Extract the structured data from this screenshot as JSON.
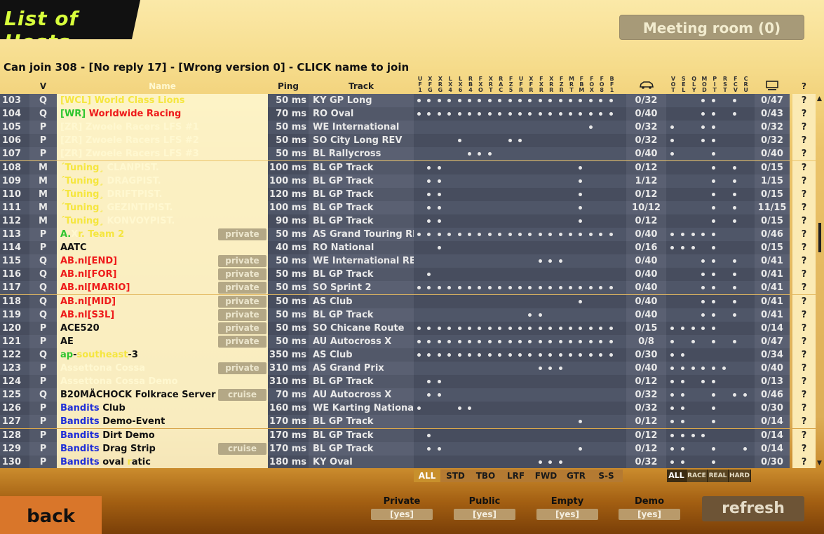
{
  "window": {
    "title": "List of Hosts",
    "meeting_room": "Meeting room (0)"
  },
  "status": "Can join 308 - [No reply 17] - [Wrong version 0] - CLICK name to join",
  "headers": {
    "v": "V",
    "name": "Name",
    "ping": "Ping",
    "track": "Track",
    "question": "?"
  },
  "car_columns": [
    "UF1",
    "XFG",
    "XRG",
    "LX4",
    "LX6",
    "RB4",
    "FXO",
    "XRT",
    "RAC",
    "FZ5",
    "UFR",
    "XFR",
    "FXR",
    "XRR",
    "FZR",
    "MRT",
    "FBM",
    "FOX",
    "FO8",
    "BF1"
  ],
  "flag_columns": [
    "VOT",
    "SEL",
    "QLY",
    "MOD",
    "PIT",
    "RST",
    "FCV",
    "CRU"
  ],
  "icons": {
    "slots": "car-icon",
    "total": "monitor-icon"
  },
  "rows": [
    {
      "no": "103",
      "v": "Q",
      "name": [
        [
          "[WCL] ",
          "#f5e640"
        ],
        [
          "World Class Lions",
          "#f5e640"
        ]
      ],
      "tag": "",
      "ping": "50 ms",
      "track": "KY GP Long",
      "cars": [
        0,
        1,
        2,
        3,
        4,
        5,
        6,
        7,
        8,
        9,
        10,
        11,
        12,
        13,
        14,
        15,
        16,
        17,
        18,
        19
      ],
      "slots": "0/32",
      "flags": [
        3,
        4,
        6
      ],
      "total": "0/47"
    },
    {
      "no": "104",
      "v": "Q",
      "name": [
        [
          "[WR] ",
          "#2ec52e"
        ],
        [
          "Worldwide Racing",
          "#ee1a1a"
        ]
      ],
      "tag": "",
      "ping": "70 ms",
      "track": "RO Oval",
      "cars": [
        0,
        1,
        2,
        3,
        4,
        5,
        6,
        7,
        8,
        9,
        10,
        11,
        12,
        13,
        14,
        15,
        16,
        17,
        18,
        19
      ],
      "slots": "0/40",
      "flags": [
        3,
        4,
        6
      ],
      "total": "0/43"
    },
    {
      "no": "105",
      "v": "P",
      "name": [
        [
          "[ZR] Zwoele Racers LFS #1",
          "#fff8d0"
        ]
      ],
      "tag": "",
      "ping": "50 ms",
      "track": "WE International",
      "cars": [
        17
      ],
      "slots": "0/32",
      "flags": [
        0,
        3,
        4
      ],
      "total": "0/32"
    },
    {
      "no": "106",
      "v": "P",
      "name": [
        [
          "[ZR] Zwoele Racers LFS #2",
          "#fff8d0"
        ]
      ],
      "tag": "",
      "ping": "50 ms",
      "track": "SO City Long REV",
      "cars": [
        4,
        9,
        10
      ],
      "slots": "0/32",
      "flags": [
        0,
        3,
        4
      ],
      "total": "0/32"
    },
    {
      "no": "107",
      "v": "P",
      "name": [
        [
          "[ZR] Zwoele Racers LFS #3",
          "#fff8d0"
        ]
      ],
      "tag": "",
      "ping": "50 ms",
      "track": "BL Rallycross",
      "cars": [
        5,
        6,
        7
      ],
      "slots": "0/40",
      "flags": [
        0,
        4
      ],
      "total": "0/40"
    },
    {
      "no": "108",
      "v": "M",
      "name": [
        [
          "´Tuning¸ ",
          "#f5e640"
        ],
        [
          "CLANPIST.",
          "#fff8d0"
        ]
      ],
      "tag": "",
      "ping": "100 ms",
      "track": "BL GP Track",
      "cars": [
        1,
        2,
        16
      ],
      "slots": "0/12",
      "flags": [
        4,
        6
      ],
      "total": "0/15"
    },
    {
      "no": "109",
      "v": "M",
      "name": [
        [
          "´Tuning¸ ",
          "#f5e640"
        ],
        [
          "DRAGPIST.",
          "#fff8d0"
        ]
      ],
      "tag": "",
      "ping": "100 ms",
      "track": "BL GP Track",
      "cars": [
        1,
        2,
        16
      ],
      "slots": "1/12",
      "flags": [
        4,
        6
      ],
      "total": "1/15"
    },
    {
      "no": "110",
      "v": "M",
      "name": [
        [
          "´Tuning¸ ",
          "#f5e640"
        ],
        [
          "DRIFTPIST.",
          "#fff8d0"
        ]
      ],
      "tag": "",
      "ping": "120 ms",
      "track": "BL GP Track",
      "cars": [
        1,
        2,
        16
      ],
      "slots": "0/12",
      "flags": [
        4,
        6
      ],
      "total": "0/15"
    },
    {
      "no": "111",
      "v": "M",
      "name": [
        [
          "´Tuning¸ ",
          "#f5e640"
        ],
        [
          "GEZINTIPIST.",
          "#fff8d0"
        ]
      ],
      "tag": "",
      "ping": "100 ms",
      "track": "BL GP Track",
      "cars": [
        1,
        2,
        16
      ],
      "slots": "10/12",
      "flags": [
        4,
        6
      ],
      "total": "11/15"
    },
    {
      "no": "112",
      "v": "M",
      "name": [
        [
          "´Tuning¸ ",
          "#f5e640"
        ],
        [
          "KONVOYPIST.",
          "#fff8d0"
        ]
      ],
      "tag": "",
      "ping": "90 ms",
      "track": "BL GP Track",
      "cars": [
        1,
        2,
        16
      ],
      "slots": "0/12",
      "flags": [
        4,
        6
      ],
      "total": "0/15"
    },
    {
      "no": "113",
      "v": "P",
      "name": [
        [
          "A.",
          "#2ec52e"
        ],
        [
          "X",
          "#fff8d0"
        ],
        [
          "r. Team 2",
          "#f5e640"
        ]
      ],
      "tag": "private",
      "ping": "50 ms",
      "track": "AS Grand Touring REV",
      "cars": [
        0,
        1,
        2,
        3,
        4,
        5,
        6,
        7,
        8,
        9,
        10,
        11,
        12,
        13,
        14,
        15,
        16,
        17,
        18,
        19
      ],
      "slots": "0/40",
      "flags": [
        0,
        1,
        2,
        3,
        4
      ],
      "total": "0/46"
    },
    {
      "no": "114",
      "v": "P",
      "name": [
        [
          "AATC",
          "#111"
        ]
      ],
      "tag": "",
      "ping": "40 ms",
      "track": "RO National",
      "cars": [
        2
      ],
      "slots": "0/16",
      "flags": [
        0,
        1,
        2,
        4
      ],
      "total": "0/15"
    },
    {
      "no": "115",
      "v": "Q",
      "name": [
        [
          "AB.nl[END]",
          "#ee1a1a"
        ]
      ],
      "tag": "private",
      "ping": "50 ms",
      "track": "WE International REV",
      "cars": [
        12,
        13,
        14
      ],
      "slots": "0/40",
      "flags": [
        3,
        4,
        6
      ],
      "total": "0/41"
    },
    {
      "no": "116",
      "v": "Q",
      "name": [
        [
          "AB.nl[FOR]",
          "#ee1a1a"
        ]
      ],
      "tag": "private",
      "ping": "50 ms",
      "track": "BL GP Track",
      "cars": [
        1
      ],
      "slots": "0/40",
      "flags": [
        3,
        4,
        6
      ],
      "total": "0/41"
    },
    {
      "no": "117",
      "v": "Q",
      "name": [
        [
          "AB.nl[MARIO]",
          "#ee1a1a"
        ]
      ],
      "tag": "private",
      "ping": "50 ms",
      "track": "SO Sprint 2",
      "cars": [
        0,
        1,
        2,
        3,
        4,
        5,
        6,
        7,
        8,
        9,
        10,
        11,
        12,
        13,
        14,
        15,
        16,
        17,
        18,
        19
      ],
      "slots": "0/40",
      "flags": [
        3,
        4,
        6
      ],
      "total": "0/41"
    },
    {
      "no": "118",
      "v": "Q",
      "name": [
        [
          "AB.nl[MID]",
          "#ee1a1a"
        ]
      ],
      "tag": "private",
      "ping": "50 ms",
      "track": "AS Club",
      "cars": [
        16
      ],
      "slots": "0/40",
      "flags": [
        3,
        4,
        6
      ],
      "total": "0/41"
    },
    {
      "no": "119",
      "v": "Q",
      "name": [
        [
          "AB.nl[S3L]",
          "#ee1a1a"
        ]
      ],
      "tag": "private",
      "ping": "50 ms",
      "track": "BL GP Track",
      "cars": [
        11,
        12
      ],
      "slots": "0/40",
      "flags": [
        3,
        4,
        6
      ],
      "total": "0/41"
    },
    {
      "no": "120",
      "v": "P",
      "name": [
        [
          "ACE520",
          "#111"
        ]
      ],
      "tag": "private",
      "ping": "50 ms",
      "track": "SO Chicane Route",
      "cars": [
        0,
        1,
        2,
        3,
        4,
        5,
        6,
        7,
        8,
        9,
        10,
        11,
        12,
        13,
        14,
        15,
        16,
        17,
        18,
        19
      ],
      "slots": "0/15",
      "flags": [
        0,
        1,
        2,
        3,
        4
      ],
      "total": "0/14"
    },
    {
      "no": "121",
      "v": "P",
      "name": [
        [
          "AE",
          "#111"
        ]
      ],
      "tag": "private",
      "ping": "50 ms",
      "track": "AU Autocross X",
      "cars": [
        0,
        1,
        2,
        3,
        4,
        5,
        6,
        7,
        8,
        9,
        10,
        11,
        12,
        13,
        14,
        15,
        16,
        17,
        18,
        19
      ],
      "slots": "0/8",
      "flags": [
        0,
        2,
        4,
        6
      ],
      "total": "0/47"
    },
    {
      "no": "122",
      "v": "Q",
      "name": [
        [
          "ap",
          "#2ec52e"
        ],
        [
          "-",
          "#111"
        ],
        [
          "southeast",
          "#f5e640"
        ],
        [
          "-3",
          "#111"
        ]
      ],
      "tag": "",
      "ping": "350 ms",
      "track": "AS Club",
      "cars": [
        0,
        1,
        2,
        3,
        4,
        5,
        6,
        7,
        8,
        9,
        10,
        11,
        12,
        13,
        14,
        15,
        16,
        17,
        18,
        19
      ],
      "slots": "0/30",
      "flags": [
        0,
        1
      ],
      "total": "0/34"
    },
    {
      "no": "123",
      "v": "P",
      "name": [
        [
          "Assettona Cossa",
          "#fff8d0"
        ]
      ],
      "tag": "private",
      "ping": "310 ms",
      "track": "AS Grand Prix",
      "cars": [
        12,
        13,
        14
      ],
      "slots": "0/40",
      "flags": [
        0,
        1,
        2,
        3,
        4,
        5
      ],
      "total": "0/40"
    },
    {
      "no": "124",
      "v": "P",
      "name": [
        [
          "Assettona Cossa Demo",
          "#fff8d0"
        ]
      ],
      "tag": "",
      "ping": "310 ms",
      "track": "BL GP Track",
      "cars": [
        1,
        2
      ],
      "slots": "0/12",
      "flags": [
        0,
        1,
        3,
        4
      ],
      "total": "0/13"
    },
    {
      "no": "125",
      "v": "Q",
      "name": [
        [
          "B20MÄCHOCK Folkrace Server",
          "#111"
        ]
      ],
      "tag": "cruise",
      "ping": "70 ms",
      "track": "AU Autocross X",
      "cars": [
        1,
        2
      ],
      "slots": "0/32",
      "flags": [
        0,
        1,
        4,
        6,
        7
      ],
      "total": "0/46"
    },
    {
      "no": "126",
      "v": "P",
      "name": [
        [
          "Bandits ",
          "#1f2ed8"
        ],
        [
          "Club",
          "#111"
        ]
      ],
      "tag": "",
      "ping": "160 ms",
      "track": "WE Karting National",
      "cars": [
        0,
        4,
        5
      ],
      "slots": "0/32",
      "flags": [
        0,
        1,
        4
      ],
      "total": "0/30"
    },
    {
      "no": "127",
      "v": "P",
      "name": [
        [
          "Bandits ",
          "#1f2ed8"
        ],
        [
          "Demo-Event",
          "#111"
        ]
      ],
      "tag": "",
      "ping": "170 ms",
      "track": "BL GP Track",
      "cars": [
        16
      ],
      "slots": "0/12",
      "flags": [
        0,
        1,
        4
      ],
      "total": "0/14"
    },
    {
      "no": "128",
      "v": "P",
      "name": [
        [
          "Bandits ",
          "#1f2ed8"
        ],
        [
          "Dirt Demo",
          "#111"
        ]
      ],
      "tag": "",
      "ping": "170 ms",
      "track": "BL GP Track",
      "cars": [
        1
      ],
      "slots": "0/12",
      "flags": [
        0,
        1,
        2,
        3
      ],
      "total": "0/14"
    },
    {
      "no": "129",
      "v": "P",
      "name": [
        [
          "Bandits ",
          "#1f2ed8"
        ],
        [
          "Drag Strip",
          "#111"
        ]
      ],
      "tag": "cruise",
      "ping": "170 ms",
      "track": "BL GP Track",
      "cars": [
        1,
        2,
        16
      ],
      "slots": "0/12",
      "flags": [
        0,
        1,
        4,
        7
      ],
      "total": "0/14"
    },
    {
      "no": "130",
      "v": "P",
      "name": [
        [
          "Bandits ",
          "#1f2ed8"
        ],
        [
          "oval ",
          "#111"
        ],
        [
          "r",
          "#f5e640"
        ],
        [
          "atic",
          "#111"
        ]
      ],
      "tag": "",
      "ping": "180 ms",
      "track": "KY Oval",
      "cars": [
        12,
        13,
        14
      ],
      "slots": "0/32",
      "flags": [
        0,
        1,
        4
      ],
      "total": "0/30"
    }
  ],
  "car_tabs": [
    "ALL",
    "STD",
    "TBO",
    "LRF",
    "FWD",
    "GTR",
    "S-S"
  ],
  "filter_tabs": [
    "ALL",
    "RACE",
    "REAL",
    "HARD"
  ],
  "filters": [
    {
      "label": "Private",
      "value": "[yes]"
    },
    {
      "label": "Public",
      "value": "[yes]"
    },
    {
      "label": "Empty",
      "value": "[yes]"
    },
    {
      "label": "Demo",
      "value": "[yes]"
    }
  ],
  "buttons": {
    "back": "back",
    "refresh": "refresh"
  },
  "colors": {
    "title_text": "#d8ff3c",
    "back_button": "#d9762a",
    "refresh_button": "#6d5436"
  }
}
